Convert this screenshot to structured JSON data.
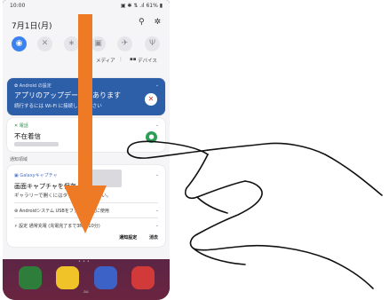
{
  "status_bar": {
    "time": "10:00",
    "indicators": "▣ ✱ ⇅ .ıl 61% ▮"
  },
  "header": {
    "date": "7月1日(月)",
    "icons": [
      "search-icon",
      "gear-icon"
    ]
  },
  "quick_settings": {
    "tiles": [
      {
        "icon": "wifi-icon",
        "glyph": "◉",
        "on": true
      },
      {
        "icon": "mute-icon",
        "glyph": "✕",
        "on": false
      },
      {
        "icon": "bluetooth-icon",
        "glyph": "∗",
        "on": false
      },
      {
        "icon": "rotate-icon",
        "glyph": "▣",
        "on": false
      },
      {
        "icon": "airplane-icon",
        "glyph": "✈",
        "on": false
      },
      {
        "icon": "flashlight-icon",
        "glyph": "Ψ",
        "on": false
      }
    ],
    "labels": {
      "media": "メディア",
      "divider": "|",
      "devices": "デバイス",
      "devices_icon": "▪▪"
    }
  },
  "notifications": {
    "android_update": {
      "header": "✿ Android の設定",
      "title": "アプリのアップデートがあります",
      "body": "続行するには Wi-Fi に接続してください",
      "action_icon": "wifi-off-icon",
      "action_glyph": "✕"
    },
    "phone": {
      "header": "✕ 電話",
      "title": "不在着信",
      "action_icon": "person-icon",
      "action_glyph": "●"
    },
    "section_label": "通知領域",
    "screenshot": {
      "header": "▣ Galaxyキャプチャ",
      "title": "画面キャプチャを保存",
      "body": "ギャラリーで開くにはタップしてください。"
    },
    "usb": {
      "text": "⊛ Androidシステム  USBをファイル転送に使用"
    },
    "charging": {
      "text": "⚡ 設定  通常充電 (充電完了まで3時間10分)"
    },
    "actions": [
      "通知設定",
      "消去"
    ]
  },
  "bottom": {
    "carrier": "au",
    "page_dots": "•••",
    "dock": [
      {
        "icon": "phone-app-icon",
        "color": "#2e7d3a"
      },
      {
        "icon": "messages-app-icon",
        "color": "#f0c428"
      },
      {
        "icon": "browser-app-icon",
        "color": "#3c62c8"
      },
      {
        "icon": "camera-app-icon",
        "color": "#d23a3a"
      }
    ]
  },
  "overlay": {
    "arrow_color": "#ee7a25",
    "description": ""
  }
}
